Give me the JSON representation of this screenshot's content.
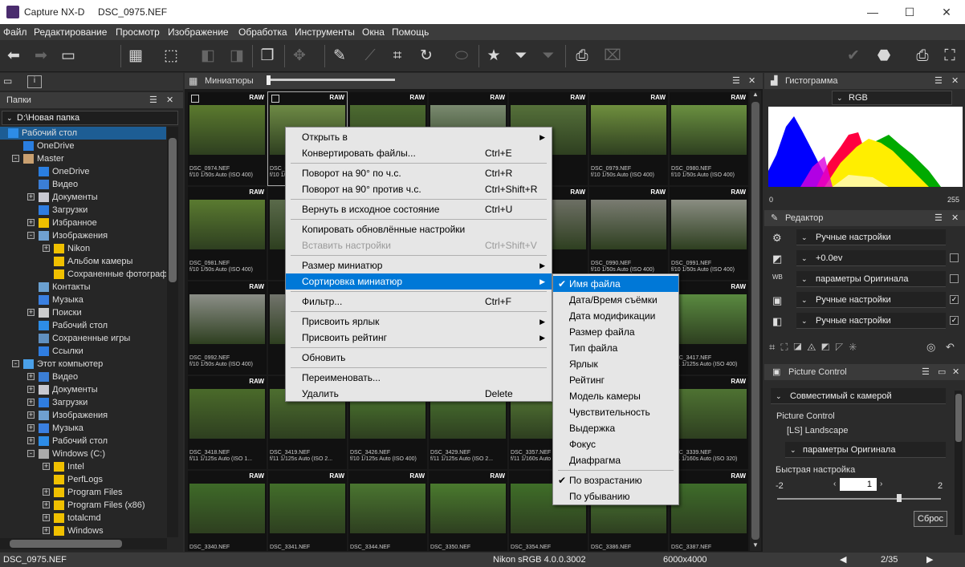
{
  "titlebar": {
    "app": "Capture NX-D",
    "file": "DSC_0975.NEF",
    "minimize": "—",
    "maximize": "☐",
    "close": "✕"
  },
  "menu": [
    "Файл",
    "Редактирование",
    "Просмотр",
    "Изображение",
    "Обработка",
    "Инструменты",
    "Окна",
    "Помощь"
  ],
  "left": {
    "folders_title": "Папки",
    "path": "D:\\Новая папка",
    "tree": [
      {
        "label": "Рабочий стол",
        "indent": 0,
        "icon": "desktop-icon",
        "exp": "",
        "sel": true
      },
      {
        "label": "OneDrive",
        "indent": 1,
        "icon": "cloud-icon",
        "exp": "",
        "sel": false
      },
      {
        "label": "Master",
        "indent": 1,
        "icon": "user-icon",
        "exp": "-",
        "sel": false
      },
      {
        "label": "OneDrive",
        "indent": 2,
        "icon": "cloud-icon",
        "exp": "",
        "sel": false
      },
      {
        "label": "Видео",
        "indent": 2,
        "icon": "video-icon",
        "exp": "",
        "sel": false
      },
      {
        "label": "Документы",
        "indent": 2,
        "icon": "documents-icon",
        "exp": "+",
        "sel": false
      },
      {
        "label": "Загрузки",
        "indent": 2,
        "icon": "download-icon",
        "exp": "",
        "sel": false
      },
      {
        "label": "Избранное",
        "indent": 2,
        "icon": "star-icon",
        "exp": "+",
        "sel": false
      },
      {
        "label": "Изображения",
        "indent": 2,
        "icon": "pictures-icon",
        "exp": "-",
        "sel": false
      },
      {
        "label": "Nikon",
        "indent": 3,
        "icon": "folder-icon",
        "exp": "+",
        "sel": false
      },
      {
        "label": "Альбом камеры",
        "indent": 3,
        "icon": "folder-icon",
        "exp": "",
        "sel": false
      },
      {
        "label": "Сохраненные фотографии",
        "indent": 3,
        "icon": "folder-icon",
        "exp": "",
        "sel": false
      },
      {
        "label": "Контакты",
        "indent": 2,
        "icon": "contacts-icon",
        "exp": "",
        "sel": false
      },
      {
        "label": "Музыка",
        "indent": 2,
        "icon": "music-icon",
        "exp": "",
        "sel": false
      },
      {
        "label": "Поиски",
        "indent": 2,
        "icon": "search-icon",
        "exp": "+",
        "sel": false
      },
      {
        "label": "Рабочий стол",
        "indent": 2,
        "icon": "desktop-icon",
        "exp": "",
        "sel": false
      },
      {
        "label": "Сохраненные игры",
        "indent": 2,
        "icon": "games-icon",
        "exp": "",
        "sel": false
      },
      {
        "label": "Ссылки",
        "indent": 2,
        "icon": "links-icon",
        "exp": "",
        "sel": false
      },
      {
        "label": "Этот компьютер",
        "indent": 1,
        "icon": "computer-icon",
        "exp": "-",
        "sel": false
      },
      {
        "label": "Видео",
        "indent": 2,
        "icon": "video-icon",
        "exp": "+",
        "sel": false
      },
      {
        "label": "Документы",
        "indent": 2,
        "icon": "documents-icon",
        "exp": "+",
        "sel": false
      },
      {
        "label": "Загрузки",
        "indent": 2,
        "icon": "download-icon",
        "exp": "+",
        "sel": false
      },
      {
        "label": "Изображения",
        "indent": 2,
        "icon": "pictures-icon",
        "exp": "+",
        "sel": false
      },
      {
        "label": "Музыка",
        "indent": 2,
        "icon": "music-icon",
        "exp": "+",
        "sel": false
      },
      {
        "label": "Рабочий стол",
        "indent": 2,
        "icon": "desktop-icon",
        "exp": "+",
        "sel": false
      },
      {
        "label": "Windows (C:)",
        "indent": 2,
        "icon": "drive-icon",
        "exp": "-",
        "sel": false
      },
      {
        "label": "Intel",
        "indent": 3,
        "icon": "folder-icon",
        "exp": "+",
        "sel": false
      },
      {
        "label": "PerfLogs",
        "indent": 3,
        "icon": "folder-icon",
        "exp": "",
        "sel": false
      },
      {
        "label": "Program Files",
        "indent": 3,
        "icon": "folder-icon",
        "exp": "+",
        "sel": false
      },
      {
        "label": "Program Files (x86)",
        "indent": 3,
        "icon": "folder-icon",
        "exp": "+",
        "sel": false
      },
      {
        "label": "totalcmd",
        "indent": 3,
        "icon": "folder-icon",
        "exp": "+",
        "sel": false
      },
      {
        "label": "Windows",
        "indent": 3,
        "icon": "folder-icon",
        "exp": "+",
        "sel": false
      }
    ]
  },
  "center": {
    "title": "Миниатюры",
    "raw": "RAW",
    "thumbs": [
      {
        "c": "#5b7a2e",
        "n1": "DSC_0974.NEF",
        "n2": "f/10 1/50s Auto (ISO 400)",
        "ed": true
      },
      {
        "c": "#6e8a45",
        "n1": "DSC_0975.NEF",
        "n2": "f/10 1/50s Auto (ISO 400)",
        "ed": true,
        "sel": true
      },
      {
        "c": "#4c6a30",
        "n1": "",
        "n2": "",
        "ed": false
      },
      {
        "c": "#7a8a70",
        "n1": "",
        "n2": "",
        "ed": false
      },
      {
        "c": "#55703a",
        "n1": "",
        "n2": "",
        "ed": false
      },
      {
        "c": "#6f8f3e",
        "n1": "DSC_0979.NEF",
        "n2": "f/10 1/50s Auto (ISO 400)",
        "ed": false
      },
      {
        "c": "#6a9040",
        "n1": "DSC_0980.NEF",
        "n2": "f/10 1/50s Auto (ISO 400)",
        "ed": false
      },
      {
        "c": "#5a7a30",
        "n1": "DSC_0981.NEF",
        "n2": "f/10 1/50s Auto (ISO 400)",
        "ed": false
      },
      {
        "c": "#5a6a4a",
        "n1": "",
        "n2": "",
        "ed": false
      },
      {
        "c": "#6b7a60",
        "n1": "",
        "n2": "",
        "ed": false
      },
      {
        "c": "#5d6c55",
        "n1": "",
        "n2": "",
        "ed": false
      },
      {
        "c": "#6d6f64",
        "n1": "",
        "n2": "",
        "ed": false
      },
      {
        "c": "#7a7c72",
        "n1": "DSC_0990.NEF",
        "n2": "f/10 1/50s Auto (ISO 400)",
        "ed": false
      },
      {
        "c": "#8a8d82",
        "n1": "DSC_0991.NEF",
        "n2": "f/10 1/50s Auto (ISO 400)",
        "ed": false
      },
      {
        "c": "#8b8e87",
        "n1": "DSC_0992.NEF",
        "n2": "f/10 1/50s Auto (ISO 400)",
        "ed": false
      },
      {
        "c": "#72746c",
        "n1": "",
        "n2": "",
        "ed": false
      },
      {
        "c": "#6a7a60",
        "n1": "",
        "n2": "",
        "ed": false
      },
      {
        "c": "#5e7048",
        "n1": "",
        "n2": "",
        "ed": false
      },
      {
        "c": "#6a7e52",
        "n1": "",
        "n2": "",
        "ed": false
      },
      {
        "c": "#607840",
        "n1": "",
        "n2": "",
        "ed": false
      },
      {
        "c": "#5a8a40",
        "n1": "DSC_3417.NEF",
        "n2": "f/11 1/125s Auto (ISO 400)",
        "ed": false
      },
      {
        "c": "#4a6a2a",
        "n1": "DSC_3418.NEF",
        "n2": "f/11 1/125s Auto (ISO 1...",
        "ed": false
      },
      {
        "c": "#4d6e2f",
        "n1": "DSC_3419.NEF",
        "n2": "f/11 1/125s Auto (ISO 2...",
        "ed": false
      },
      {
        "c": "#4e7a30",
        "n1": "DSC_3426.NEF",
        "n2": "f/10 1/125s Auto (ISO 400)",
        "ed": false
      },
      {
        "c": "#4a7530",
        "n1": "DSC_3429.NEF",
        "n2": "f/11 1/125s Auto (ISO 2...",
        "ed": false
      },
      {
        "c": "#567a36",
        "n1": "DSC_3357.NEF",
        "n2": "f/11 1/160s Auto (ISO 8...",
        "ed": false
      },
      {
        "c": "#557835",
        "n1": "",
        "n2": "",
        "ed": false
      },
      {
        "c": "#4e7232",
        "n1": "DSC_3339.NEF",
        "n2": "f/11 1/160s Auto (ISO 320)",
        "ed": false
      },
      {
        "c": "#3e6a28",
        "n1": "DSC_3340.NEF",
        "n2": "",
        "ed": false
      },
      {
        "c": "#426e2a",
        "n1": "DSC_3341.NEF",
        "n2": "",
        "ed": false
      },
      {
        "c": "#4a7530",
        "n1": "DSC_3344.NEF",
        "n2": "",
        "ed": false
      },
      {
        "c": "#4a7a2e",
        "n1": "DSC_3350.NEF",
        "n2": "",
        "ed": false
      },
      {
        "c": "#3f6e28",
        "n1": "DSC_3354.NEF",
        "n2": "",
        "ed": false
      },
      {
        "c": "#4c7a34",
        "n1": "DSC_3386.NEF",
        "n2": "",
        "ed": false
      },
      {
        "c": "#3e6c2a",
        "n1": "DSC_3387.NEF",
        "n2": "",
        "ed": false
      }
    ]
  },
  "context_menu": {
    "items": [
      {
        "l": "Открыть в",
        "s": "",
        "a": true
      },
      {
        "l": "Конвертировать файлы...",
        "s": "Ctrl+E"
      },
      {
        "sep": true
      },
      {
        "l": "Поворот на 90° по ч.с.",
        "s": "Ctrl+R"
      },
      {
        "l": "Поворот на 90° против ч.с.",
        "s": "Ctrl+Shift+R"
      },
      {
        "sep": true
      },
      {
        "l": "Вернуть в исходное состояние",
        "s": "Ctrl+U"
      },
      {
        "sep": true
      },
      {
        "l": "Копировать обновлённые настройки",
        "s": ""
      },
      {
        "l": "Вставить настройки",
        "s": "Ctrl+Shift+V",
        "dis": true
      },
      {
        "sep": true
      },
      {
        "l": "Размер миниатюр",
        "s": "",
        "a": true
      },
      {
        "l": "Сортировка миниатюр",
        "s": "",
        "a": true,
        "hi": true
      },
      {
        "sep": true
      },
      {
        "l": "Фильтр...",
        "s": "Ctrl+F"
      },
      {
        "sep": true
      },
      {
        "l": "Присвоить ярлык",
        "s": "",
        "a": true
      },
      {
        "l": "Присвоить рейтинг",
        "s": "",
        "a": true
      },
      {
        "sep": true
      },
      {
        "l": "Обновить",
        "s": ""
      },
      {
        "sep": true
      },
      {
        "l": "Переименовать...",
        "s": ""
      },
      {
        "l": "Удалить",
        "s": "Delete"
      }
    ]
  },
  "sort_menu": {
    "items": [
      {
        "l": "Имя файла",
        "chk": true,
        "hi": true
      },
      {
        "l": "Дата/Время съёмки"
      },
      {
        "l": "Дата модификации"
      },
      {
        "l": "Размер файла"
      },
      {
        "l": "Тип файла"
      },
      {
        "l": "Ярлык"
      },
      {
        "l": "Рейтинг"
      },
      {
        "l": "Модель камеры"
      },
      {
        "l": "Чувствительность"
      },
      {
        "l": "Выдержка"
      },
      {
        "l": "Фокус"
      },
      {
        "l": "Диафрагма"
      },
      {
        "sep": true
      },
      {
        "l": "По возрастанию",
        "chk": true
      },
      {
        "l": "По убыванию"
      }
    ]
  },
  "right": {
    "histogram_title": "Гистограмма",
    "channel": "RGB",
    "hist_min": "0",
    "hist_max": "255",
    "editor_title": "Редактор",
    "editor_rows": [
      {
        "icon": "gear-icon",
        "label": "Ручные настройки",
        "chk": null
      },
      {
        "icon": "exposure-icon",
        "label": "+0.0ev",
        "chk": false
      },
      {
        "icon": "wb-icon",
        "label": "параметры Оригинала",
        "chk": false
      },
      {
        "icon": "picture-control-icon",
        "label": "Ручные настройки",
        "chk": true
      },
      {
        "icon": "levels-icon",
        "label": "Ручные настройки",
        "chk": true
      }
    ],
    "pc_title": "Picture Control",
    "pc_mode": "Совместимый с камерой",
    "pc_label": "Picture Control",
    "pc_value": "[LS] Landscape",
    "pc_preset": "параметры Оригинала",
    "quick_label": "Быстрая настройка",
    "quick_min": "-2",
    "quick_max": "2",
    "quick_value": "1",
    "reset": "Сброс"
  },
  "status": {
    "file": "DSC_0975.NEF",
    "profile": "Nikon sRGB 4.0.0.3002",
    "size": "6000x4000",
    "page": "2/35"
  },
  "colors": {
    "accent": "#0078d7",
    "panel": "#2b2b2b",
    "header": "#3a3a3a"
  }
}
